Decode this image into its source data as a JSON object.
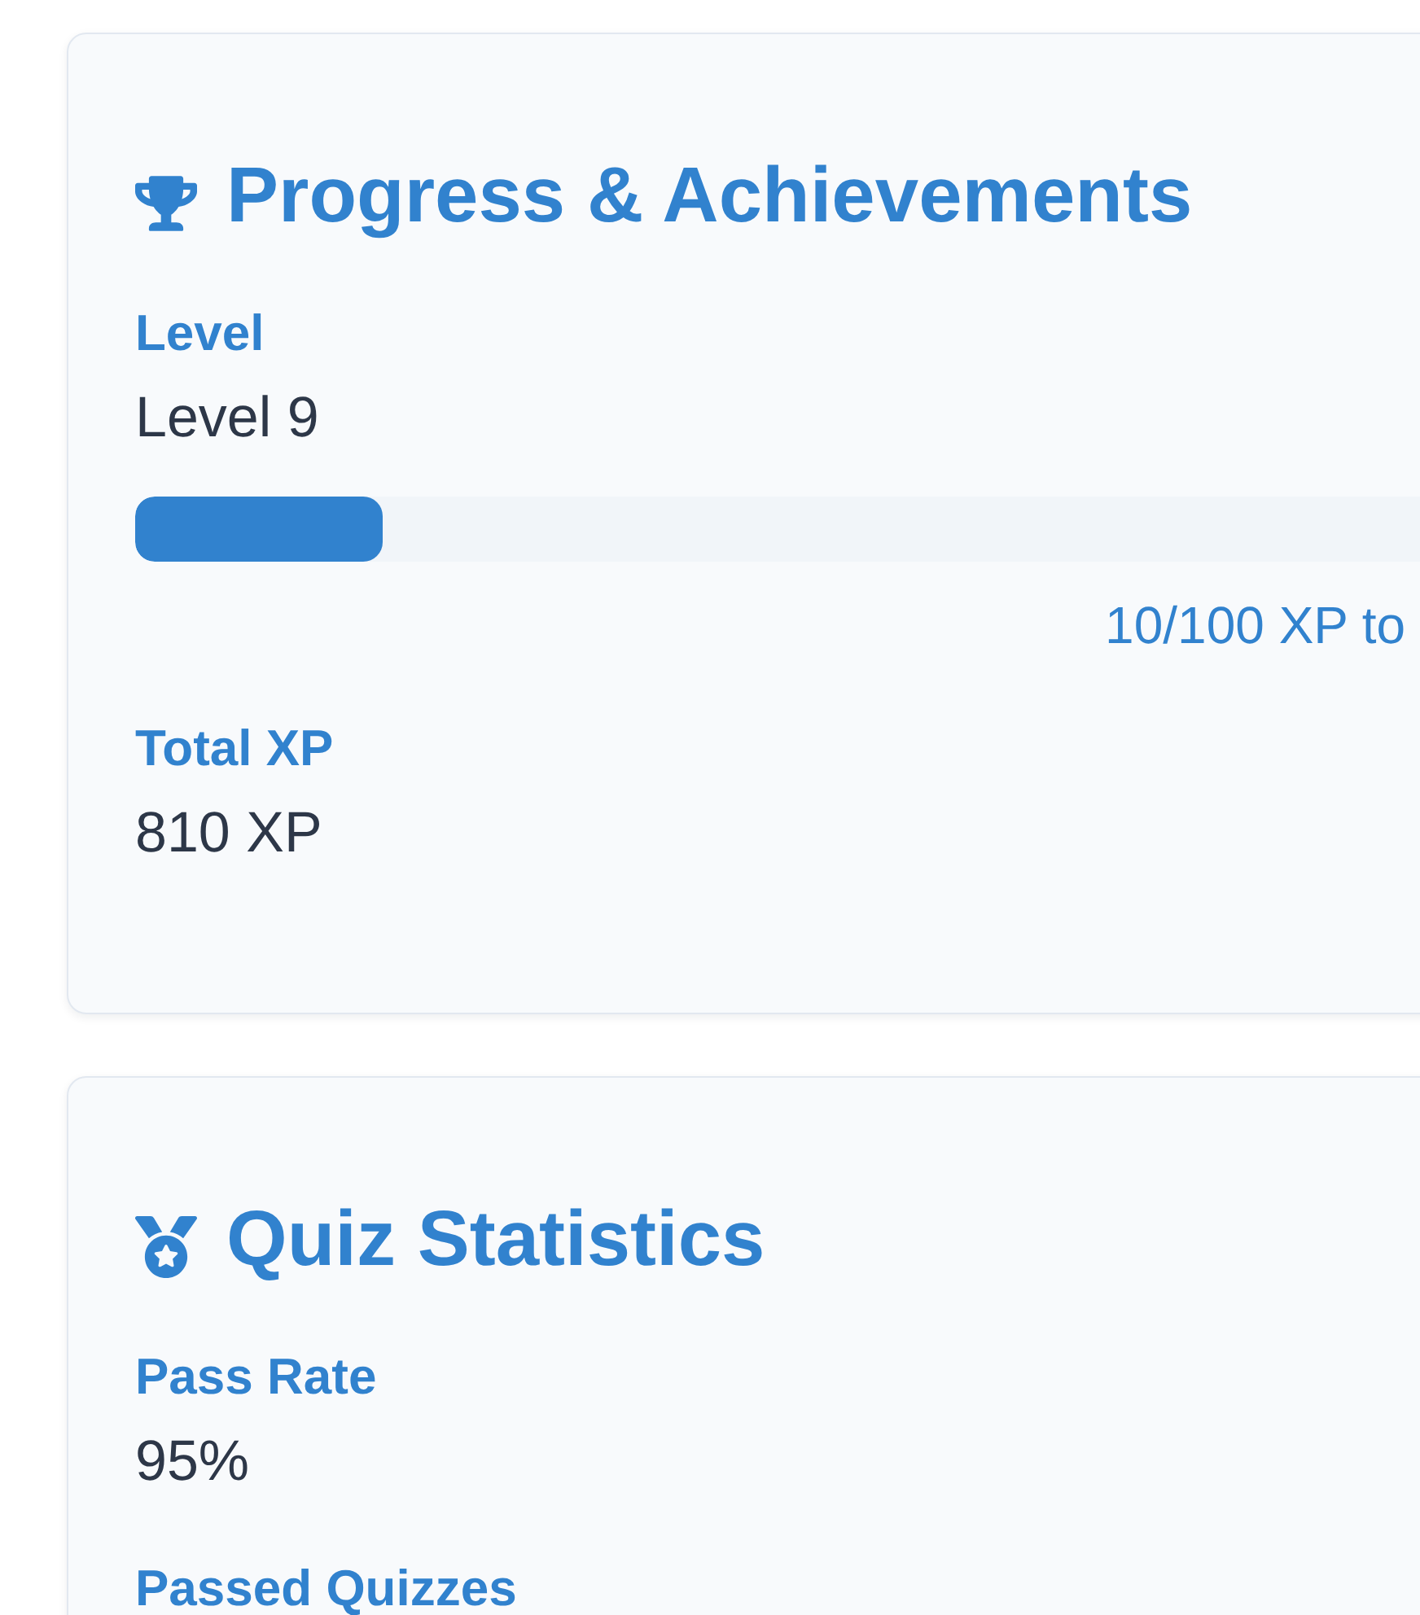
{
  "sections": [
    {
      "kind": "progress",
      "title": "Progress & Achievements",
      "stats": [
        {
          "kind": "bar",
          "label": "Level",
          "value": "Level 9",
          "level": 0.1,
          "caption": "10/100 XP to"
        },
        {
          "kind": "plain",
          "label": "Total XP",
          "value": "810 XP"
        }
      ]
    },
    {
      "kind": "quiz",
      "title": "Quiz Statistics",
      "stats": [
        {
          "kind": "plain",
          "label": "Pass Rate",
          "value": "95%"
        },
        {
          "kind": "plain",
          "label": "Passed Quizzes"
        }
      ]
    }
  ]
}
